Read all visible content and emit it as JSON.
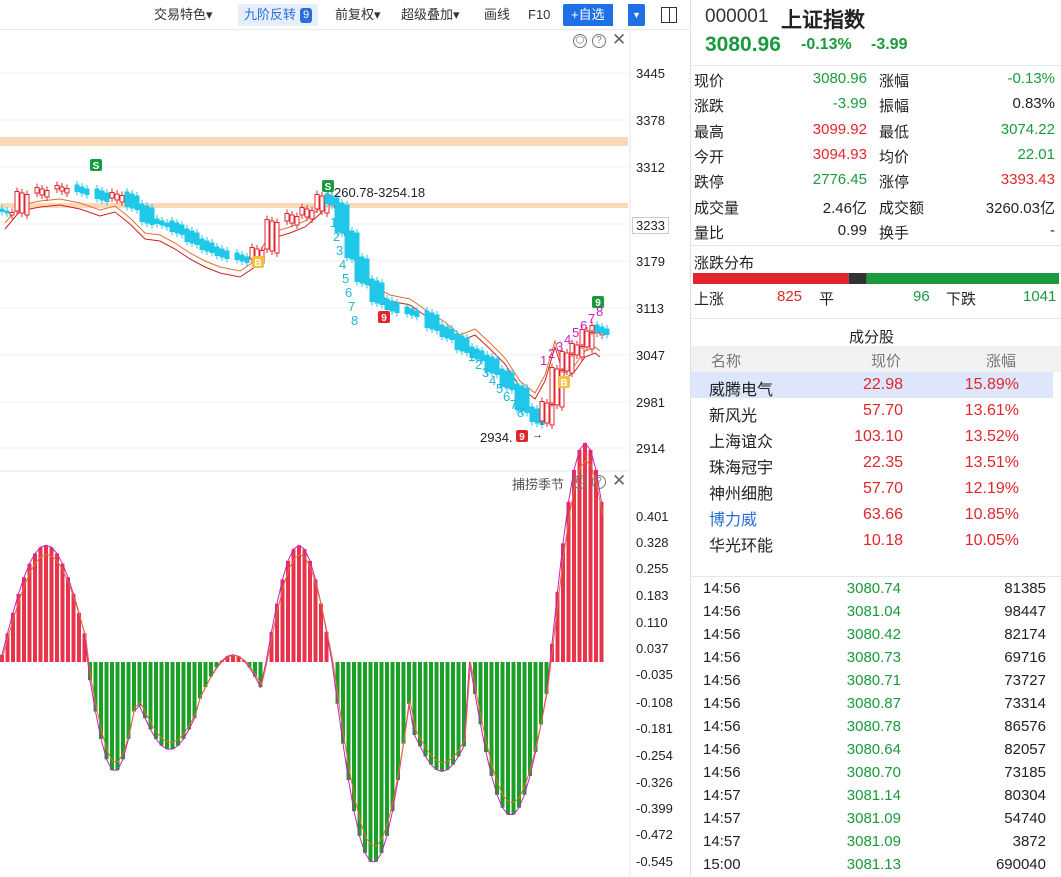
{
  "toolbar": {
    "items": [
      "交易特色",
      "九阶反转",
      "前复权",
      "超级叠加",
      "画线",
      "F10",
      "+自选"
    ],
    "nine_badge": "9"
  },
  "main_chart": {
    "y_ticks": [
      "3445",
      "3378",
      "3312",
      "3233",
      "3179",
      "3113",
      "3047",
      "2981",
      "2914"
    ],
    "current_price_label": "3233",
    "range_label": "260.78-3254.18",
    "low_label": "2934.",
    "low_signal": "9",
    "signals": {
      "s": "S",
      "b": "B",
      "nine": "9"
    },
    "seq_down_1": [
      "1",
      "2",
      "3",
      "4",
      "5",
      "6",
      "7",
      "8"
    ],
    "seq_down_2": [
      "1",
      "2",
      "3",
      "4",
      "5",
      "6",
      "7",
      "8"
    ],
    "seq_up": [
      "1",
      "2",
      "3",
      "4",
      "5",
      "6",
      "7",
      "8"
    ]
  },
  "sub_chart": {
    "title": "捕捞季节",
    "y_ticks": [
      "0.401",
      "0.328",
      "0.255",
      "0.183",
      "0.110",
      "0.037",
      "-0.035",
      "-0.108",
      "-0.181",
      "-0.254",
      "-0.326",
      "-0.399",
      "-0.472",
      "-0.545"
    ]
  },
  "quote": {
    "code": "000001",
    "name": "上证指数",
    "price": "3080.96",
    "change_pct": "-0.13%",
    "change": "-3.99",
    "rows": [
      {
        "l1": "现价",
        "v1": "3080.96",
        "c1": "dn",
        "l2": "涨幅",
        "v2": "-0.13%",
        "c2": "dn"
      },
      {
        "l1": "涨跌",
        "v1": "-3.99",
        "c1": "dn",
        "l2": "振幅",
        "v2": "0.83%",
        "c2": "bk"
      },
      {
        "l1": "最高",
        "v1": "3099.92",
        "c1": "up",
        "l2": "最低",
        "v2": "3074.22",
        "c2": "dn"
      },
      {
        "l1": "今开",
        "v1": "3094.93",
        "c1": "up",
        "l2": "均价",
        "v2": "22.01",
        "c2": "dn"
      },
      {
        "l1": "跌停",
        "v1": "2776.45",
        "c1": "dn",
        "l2": "涨停",
        "v2": "3393.43",
        "c2": "up"
      },
      {
        "l1": "成交量",
        "v1": "2.46亿",
        "c1": "bk",
        "l2": "成交额",
        "v2": "3260.03亿",
        "c2": "bk"
      },
      {
        "l1": "量比",
        "v1": "0.99",
        "c1": "bk",
        "l2": "换手",
        "v2": "-",
        "c2": "bk"
      }
    ]
  },
  "distribution": {
    "title": "涨跌分布",
    "up_label": "上涨",
    "up_count": "825",
    "flat_label": "平",
    "flat_count": "96",
    "down_label": "下跌",
    "down_count": "1041",
    "colors": {
      "up": "#e0262c",
      "flat": "#333333",
      "down": "#1a9a3c"
    }
  },
  "constituents": {
    "title": "成分股",
    "headers": [
      "名称",
      "现价",
      "涨幅"
    ],
    "rows": [
      {
        "name": "威腾电气",
        "price": "22.98",
        "pct": "15.89%"
      },
      {
        "name": "新风光",
        "price": "57.70",
        "pct": "13.61%"
      },
      {
        "name": "上海谊众",
        "price": "103.10",
        "pct": "13.52%"
      },
      {
        "name": "珠海冠宇",
        "price": "22.35",
        "pct": "13.51%"
      },
      {
        "name": "神州细胞",
        "price": "57.70",
        "pct": "12.19%"
      },
      {
        "name": "博力威",
        "price": "63.66",
        "pct": "10.85%"
      },
      {
        "name": "华光环能",
        "price": "10.18",
        "pct": "10.05%"
      }
    ]
  },
  "ticks": [
    {
      "t": "14:56",
      "p": "3080.74",
      "v": "81385"
    },
    {
      "t": "14:56",
      "p": "3081.04",
      "v": "98447"
    },
    {
      "t": "14:56",
      "p": "3080.42",
      "v": "82174"
    },
    {
      "t": "14:56",
      "p": "3080.73",
      "v": "69716"
    },
    {
      "t": "14:56",
      "p": "3080.71",
      "v": "73727"
    },
    {
      "t": "14:56",
      "p": "3080.87",
      "v": "73314"
    },
    {
      "t": "14:56",
      "p": "3080.78",
      "v": "86576"
    },
    {
      "t": "14:56",
      "p": "3080.64",
      "v": "82057"
    },
    {
      "t": "14:56",
      "p": "3080.70",
      "v": "73185"
    },
    {
      "t": "14:57",
      "p": "3081.14",
      "v": "80304"
    },
    {
      "t": "14:57",
      "p": "3081.09",
      "v": "54740"
    },
    {
      "t": "14:57",
      "p": "3081.09",
      "v": "3872"
    },
    {
      "t": "15:00",
      "p": "3081.13",
      "v": "690040"
    }
  ]
}
